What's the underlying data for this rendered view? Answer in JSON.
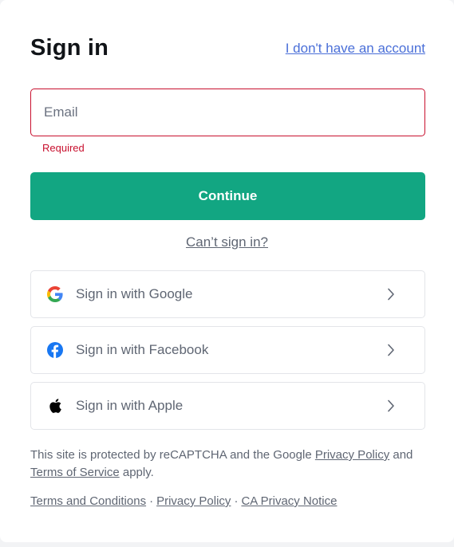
{
  "title": "Sign in",
  "no_account_link": "I don't have an account",
  "email": {
    "placeholder": "Email",
    "value": "",
    "error": "Required"
  },
  "continue_label": "Continue",
  "cant_sign_in": "Can’t sign in?",
  "social": [
    {
      "label": "Sign in with Google",
      "icon": "google-icon"
    },
    {
      "label": "Sign in with Facebook",
      "icon": "facebook-icon"
    },
    {
      "label": "Sign in with Apple",
      "icon": "apple-icon"
    }
  ],
  "legal": {
    "prefix": "This site is protected by reCAPTCHA and the Google",
    "privacy_policy": "Privacy Policy",
    "and": "and",
    "terms_of_service": "Terms of Service",
    "suffix": "apply."
  },
  "footer": {
    "terms": "Terms and Conditions",
    "separator": "·",
    "privacy": "Privacy Policy",
    "ca_privacy": "CA Privacy Notice"
  },
  "colors": {
    "accent": "#12a682",
    "error": "#c8102e",
    "link": "#4a6fd8",
    "facebook": "#1877f2"
  }
}
